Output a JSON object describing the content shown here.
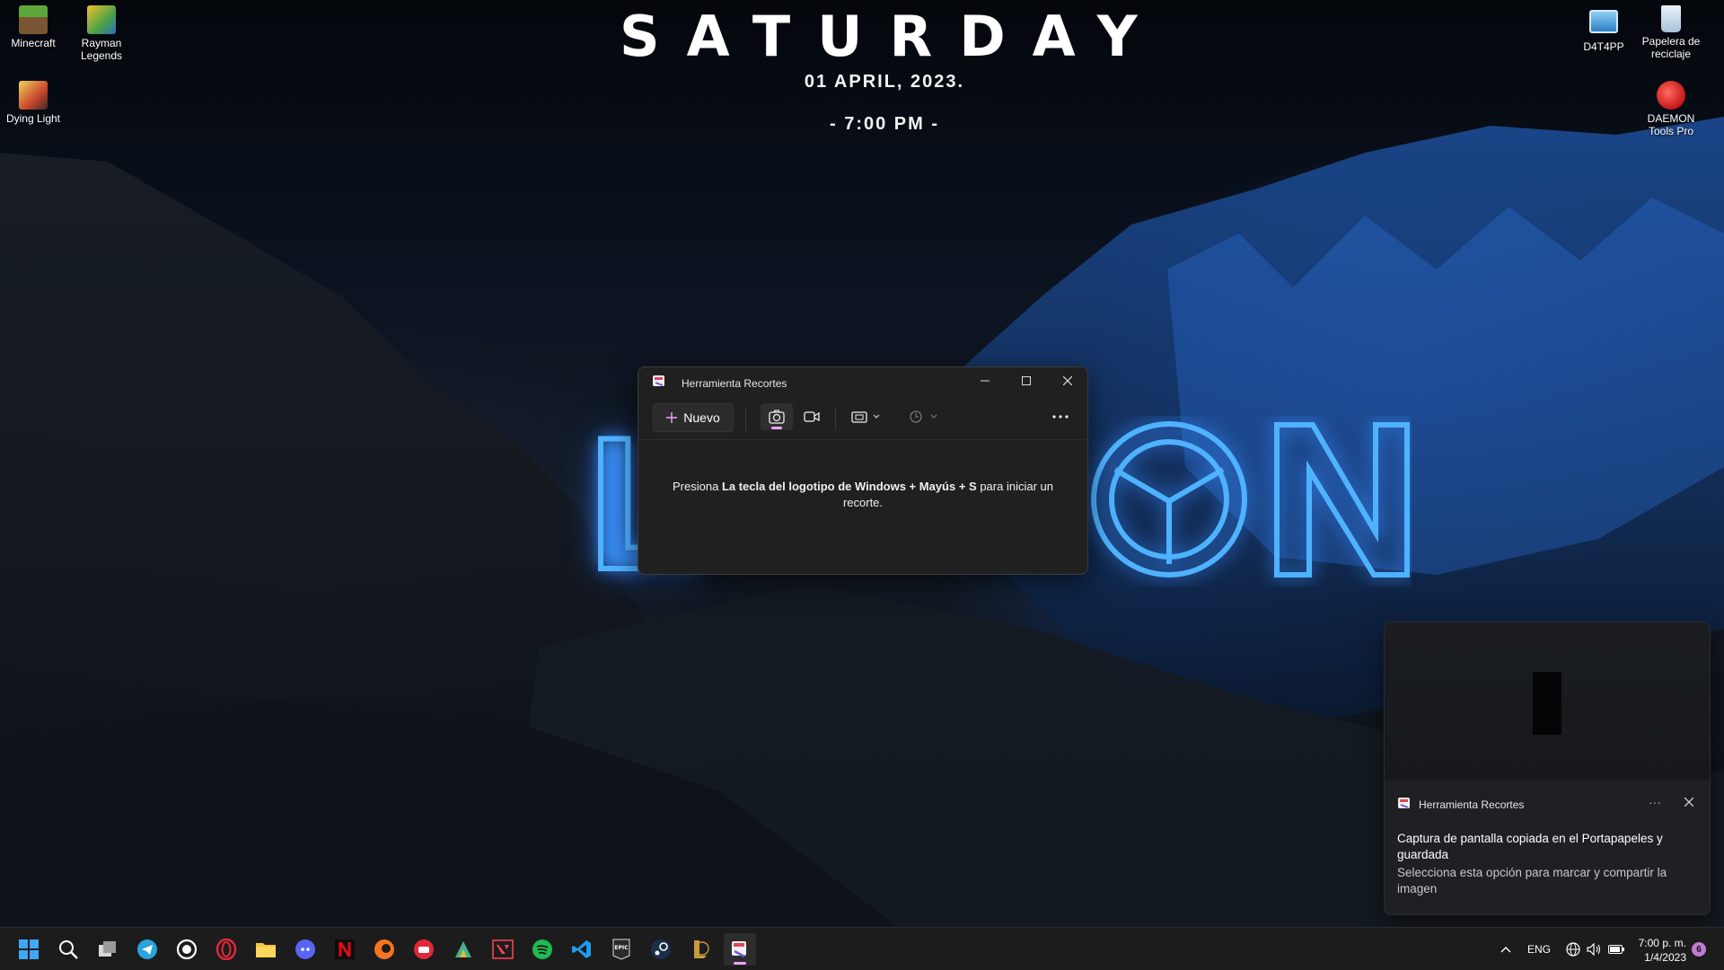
{
  "clock_widget": {
    "day": "SATURDAY",
    "date": "01 APRIL, 2023.",
    "time": "- 7:00 PM -"
  },
  "wallpaper_text": "LION",
  "desktop_icons": [
    {
      "label": "Minecraft",
      "icon": "minecraft-icon"
    },
    {
      "label": "Rayman Legends",
      "icon": "rayman-legends-icon"
    },
    {
      "label": "Dying Light",
      "icon": "dying-light-icon"
    },
    {
      "label": "D4T4PP",
      "icon": "d4t4pp-icon"
    },
    {
      "label": "Papelera de reciclaje",
      "icon": "recycle-bin-icon"
    },
    {
      "label": "DAEMON Tools Pro",
      "icon": "daemon-tools-icon"
    }
  ],
  "snipping_tool": {
    "title": "Herramienta Recortes",
    "new_button": "Nuevo",
    "message_prefix": "Presiona ",
    "message_bold": "La tecla del logotipo de Windows + Mayús + S",
    "message_suffix": " para iniciar un recorte.",
    "modes": [
      "screenshot-mode",
      "video-mode"
    ],
    "active_mode": "screenshot-mode"
  },
  "notification": {
    "app": "Herramienta Recortes",
    "title": "Captura de pantalla copiada en el Portapapeles y guardada",
    "body": "Selecciona esta opción para marcar y compartir la imagen",
    "more": "···"
  },
  "taskbar": {
    "apps": [
      "start",
      "search",
      "task-view",
      "telegram",
      "whatsapp",
      "opera",
      "file-explorer",
      "discord",
      "netflix",
      "crunchyroll",
      "game-app",
      "design-app",
      "valorant",
      "spotify",
      "vscode",
      "epic-games",
      "steam",
      "league-of-legends",
      "snipping-tool"
    ],
    "active_app": "snipping-tool",
    "language": "ENG",
    "time": "7:00 p. m.",
    "date": "1/4/2023",
    "notification_count": "6"
  },
  "colors": {
    "neon": "#4fb2ff",
    "accent": "#e9a7f4",
    "window_bg": "#202020",
    "taskbar_bg": "#1c1c1c"
  }
}
